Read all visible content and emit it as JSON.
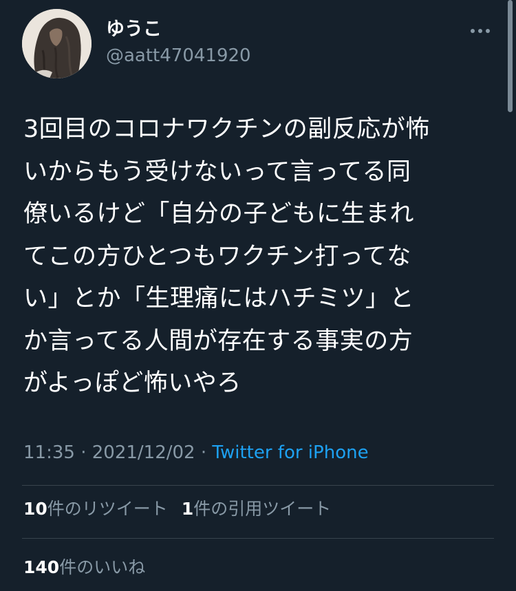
{
  "user": {
    "display_name": "ゆうこ",
    "handle": "@aatt47041920"
  },
  "tweet": {
    "text": "3回目のコロナワクチンの副反応が怖\nいからもう受けないって言ってる同\n僚いるけど「自分の子どもに生まれ\nてこの方ひとつもワクチン打ってな\nい」とか「生理痛にはハチミツ」と\nか言ってる人間が存在する事実の方\nがよっぽど怖いやろ",
    "time": "11:35",
    "separator": "·",
    "date": "2021/12/02",
    "source": "Twitter for iPhone"
  },
  "stats": {
    "retweets_count": "10",
    "retweets_label": "件のリツイート",
    "quotes_count": "1",
    "quotes_label": "件の引用ツイート",
    "likes_count": "140",
    "likes_label": "件のいいね"
  },
  "icons": {
    "more": "more-horizontal-icon",
    "avatar": "profile-photo"
  },
  "colors": {
    "background": "#15202b",
    "text": "#ffffff",
    "secondary_text": "#8899a6",
    "link": "#1da1f2",
    "divider": "#38444d"
  }
}
